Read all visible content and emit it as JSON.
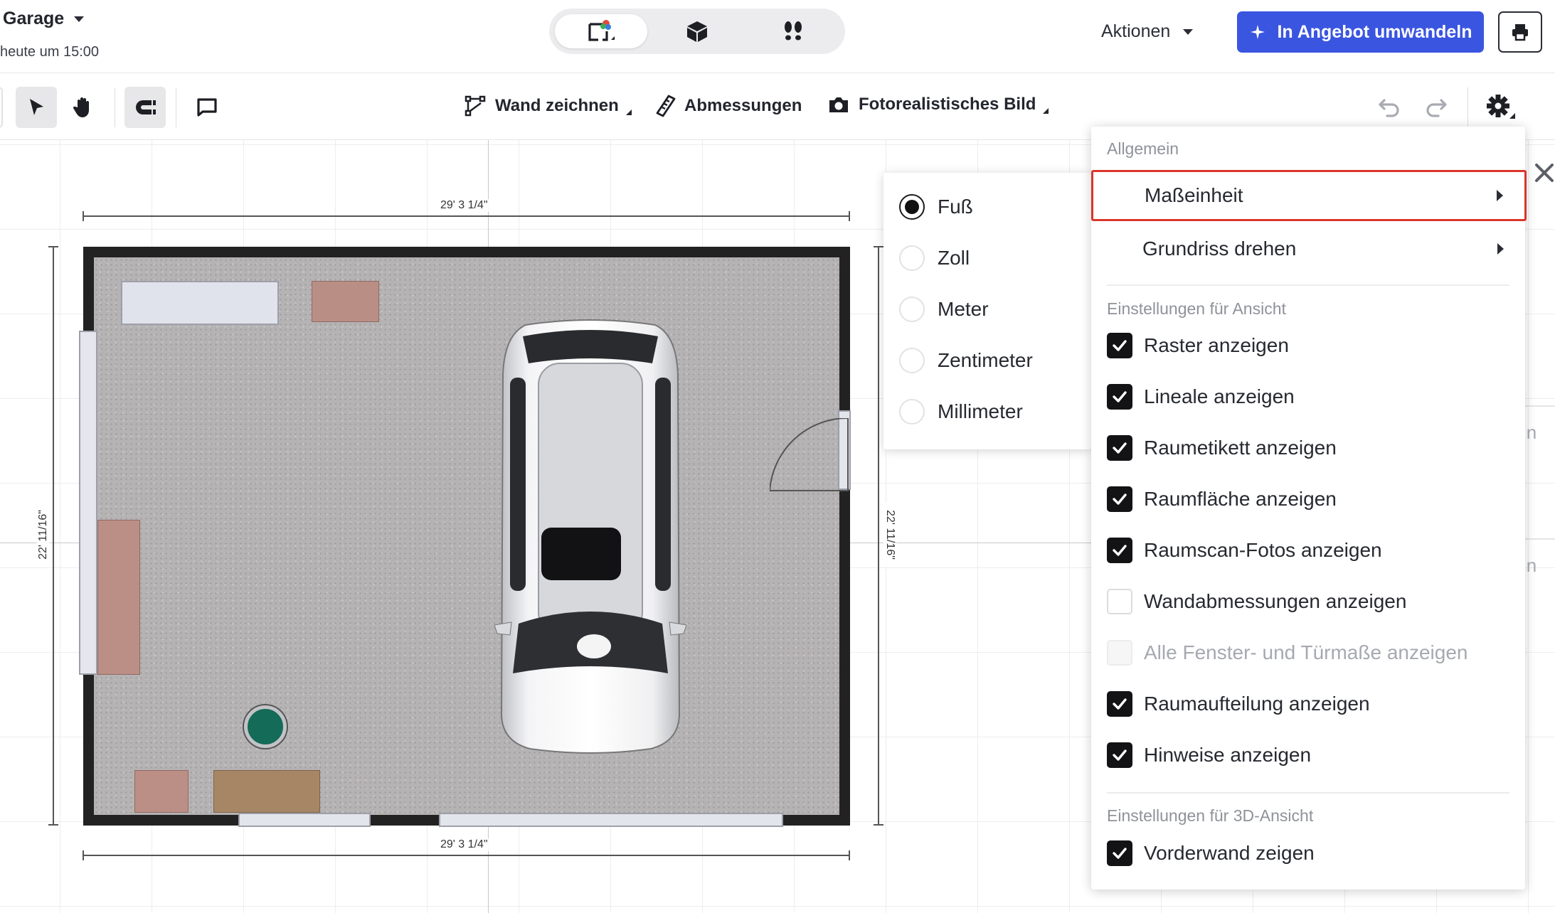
{
  "header": {
    "project_title": "Garage",
    "project_subtitle": "heute um 15:00",
    "view_modes": [
      "2d-floorplan",
      "3d-view",
      "walkthrough"
    ],
    "actions_label": "Aktionen",
    "convert_label": "In Angebot umwandeln",
    "brand_color": "#3a55e0"
  },
  "toolbar": {
    "draw_wall_label": "Wand zeichnen",
    "dimensions_label": "Abmessungen",
    "photo_label": "Fotorealistisches Bild"
  },
  "plan": {
    "top_dimension": "29' 3 1/4\"",
    "bottom_dimension": "29' 3 1/4\"",
    "left_dimension": "22' 11/16\"",
    "right_dimension": "22' 11/16\""
  },
  "unit_submenu": {
    "selected": "Fuß",
    "options": [
      {
        "label": "Fuß",
        "checked": true
      },
      {
        "label": "Zoll",
        "checked": false
      },
      {
        "label": "Meter",
        "checked": false
      },
      {
        "label": "Zentimeter",
        "checked": false
      },
      {
        "label": "Millimeter",
        "checked": false
      }
    ]
  },
  "settings_menu": {
    "general_heading": "Allgemein",
    "unit_item": "Maßeinheit",
    "rotate_item": "Grundriss drehen",
    "view_heading": "Einstellungen für Ansicht",
    "view_options": [
      {
        "label": "Raster anzeigen",
        "checked": true
      },
      {
        "label": "Lineale anzeigen",
        "checked": true
      },
      {
        "label": "Raumetikett anzeigen",
        "checked": true
      },
      {
        "label": "Raumfläche anzeigen",
        "checked": true
      },
      {
        "label": "Raumscan-Fotos anzeigen",
        "checked": true
      },
      {
        "label": "Wandabmessungen anzeigen",
        "checked": false
      },
      {
        "label": "Alle Fenster- und Türmaße anzeigen",
        "checked": false,
        "disabled": true
      },
      {
        "label": "Raumaufteilung anzeigen",
        "checked": true
      },
      {
        "label": "Hinweise anzeigen",
        "checked": true
      }
    ],
    "view3d_heading": "Einstellungen für 3D-Ansicht",
    "view3d_options": [
      {
        "label": "Vorderwand zeigen",
        "checked": true
      }
    ],
    "highlight_color": "#d9362c"
  },
  "side_panel_fragments": [
    "in",
    "in"
  ]
}
